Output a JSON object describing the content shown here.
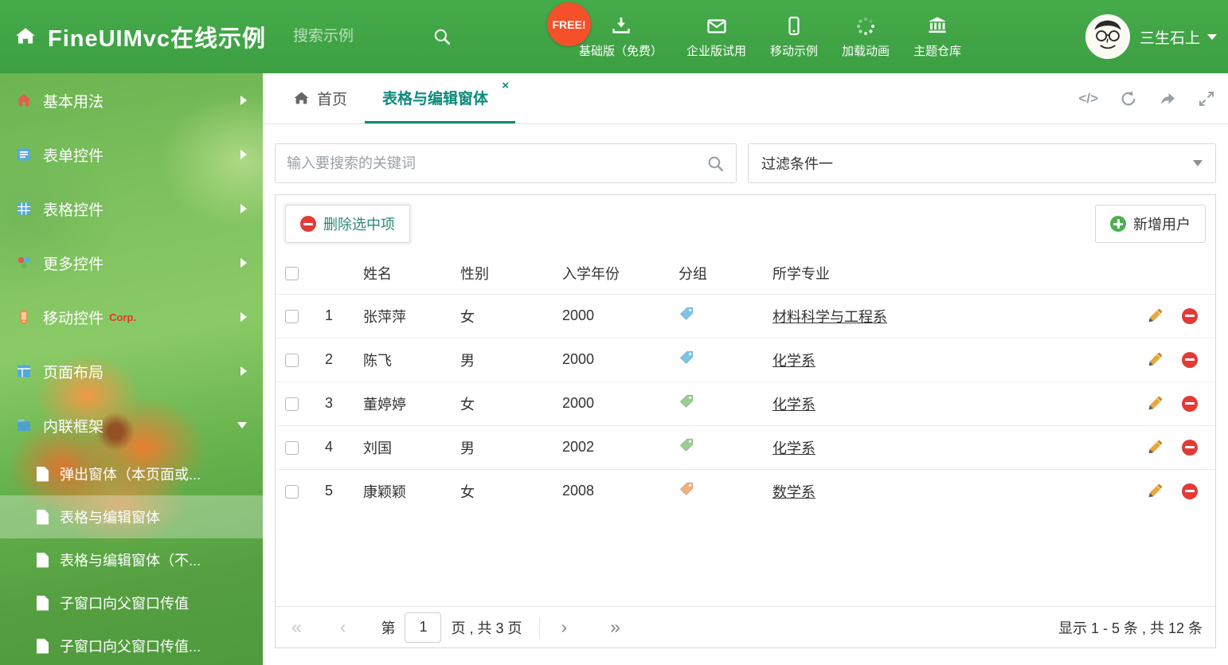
{
  "colors": {
    "header_green": "#41a747",
    "active_tab_teal": "#0b8a7c",
    "free_badge_red": "#f4502a",
    "corp_badge_red": "#e0372a"
  },
  "icons": {
    "code_icon": "</>",
    "close_icon": "×",
    "first_icon": "«",
    "prev_icon": "‹",
    "next_icon": "›",
    "last_icon": "»"
  },
  "header": {
    "title": "FineUIMvc在线示例",
    "search_placeholder": "搜索示例",
    "free_badge": "FREE!",
    "nav": [
      {
        "label": "基础版（免费）",
        "icon": "download-icon"
      },
      {
        "label": "企业版试用",
        "icon": "mail-icon"
      },
      {
        "label": "移动示例",
        "icon": "mobile-icon"
      },
      {
        "label": "加载动画",
        "icon": "spinner-icon"
      },
      {
        "label": "主题仓库",
        "icon": "bank-icon"
      }
    ],
    "user_name": "三生石上"
  },
  "sidebar": {
    "items": [
      {
        "label": "基本用法",
        "icon": "home-icon"
      },
      {
        "label": "表单控件",
        "icon": "form-icon"
      },
      {
        "label": "表格控件",
        "icon": "table-icon"
      },
      {
        "label": "更多控件",
        "icon": "widgets-icon"
      },
      {
        "label": "移动控件",
        "icon": "mobile-icon",
        "badge": "Corp."
      },
      {
        "label": "页面布局",
        "icon": "layout-icon"
      },
      {
        "label": "内联框架",
        "icon": "iframe-icon",
        "expanded": true
      }
    ],
    "subitems": [
      {
        "label": "弹出窗体（本页面或..."
      },
      {
        "label": "表格与编辑窗体",
        "selected": true
      },
      {
        "label": "表格与编辑窗体（不..."
      },
      {
        "label": "子窗口向父窗口传值"
      },
      {
        "label": "子窗口向父窗口传值..."
      }
    ]
  },
  "tabs": {
    "home_label": "首页",
    "active_label": "表格与编辑窗体"
  },
  "filter": {
    "search_placeholder": "输入要搜索的关键词",
    "dropdown_value": "过滤条件一"
  },
  "grid": {
    "delete_button": "删除选中项",
    "add_button": "新增用户",
    "columns": {
      "name": "姓名",
      "gender": "性别",
      "year": "入学年份",
      "group": "分组",
      "major": "所学专业"
    },
    "rows": [
      {
        "num": "1",
        "name": "张萍萍",
        "gender": "女",
        "year": "2000",
        "tag_color": "#7cc5e8",
        "major": "材料科学与工程系"
      },
      {
        "num": "2",
        "name": "陈飞",
        "gender": "男",
        "year": "2000",
        "tag_color": "#7cc5e8",
        "major": "化学系"
      },
      {
        "num": "3",
        "name": "董婷婷",
        "gender": "女",
        "year": "2000",
        "tag_color": "#97cf8f",
        "major": "化学系"
      },
      {
        "num": "4",
        "name": "刘国",
        "gender": "男",
        "year": "2002",
        "tag_color": "#97cf8f",
        "major": "化学系"
      },
      {
        "num": "5",
        "name": "康颖颖",
        "gender": "女",
        "year": "2008",
        "tag_color": "#f2b079",
        "major": "数学系"
      }
    ],
    "pagination": {
      "page_prefix": "第",
      "page_value": "1",
      "page_suffix": "页 , 共 3 页",
      "summary": "显示 1 - 5 条 , 共 12 条"
    }
  }
}
